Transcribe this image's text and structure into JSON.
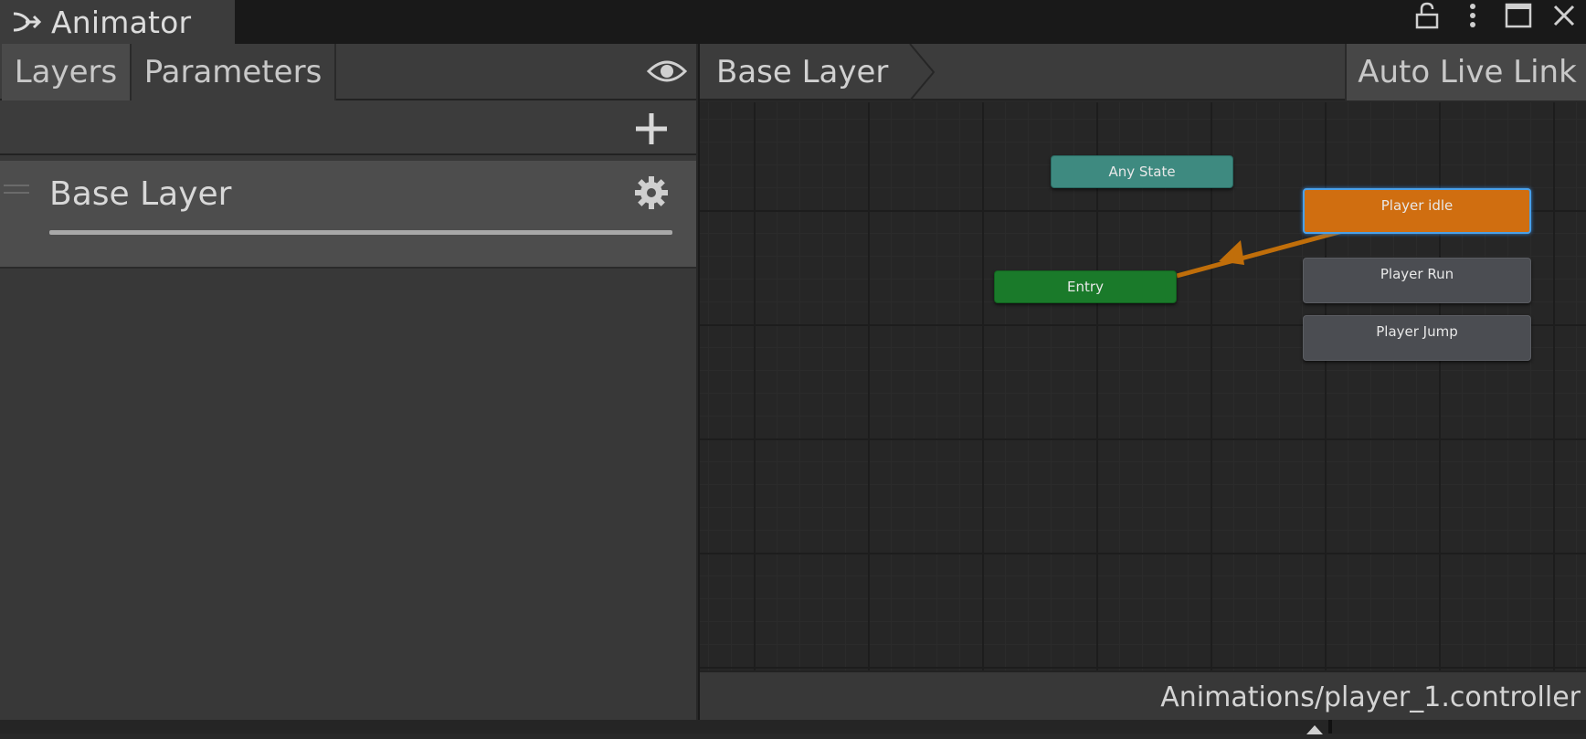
{
  "window": {
    "title": "Animator",
    "controls": [
      "lock-icon",
      "more-icon",
      "maximize-icon",
      "close-icon"
    ]
  },
  "left_panel": {
    "tabs": [
      {
        "label": "Layers",
        "active": true
      },
      {
        "label": "Parameters",
        "active": false
      }
    ],
    "layers": [
      {
        "name": "Base Layer"
      }
    ]
  },
  "right_panel": {
    "breadcrumb": "Base Layer",
    "live_link_button": "Auto Live Link",
    "states": {
      "any_state": "Any State",
      "entry": "Entry",
      "player_idle": "Player idle",
      "player_run": "Player Run",
      "player_jump": "Player Jump"
    },
    "asset_path": "Animations/player_1.controller"
  },
  "colors": {
    "any_state": "#3e8a80",
    "entry": "#1a7a2a",
    "default_state": "#d06e10",
    "state": "#4b4d52",
    "selection": "#4aa0e8",
    "transition": "#c06e0a"
  }
}
